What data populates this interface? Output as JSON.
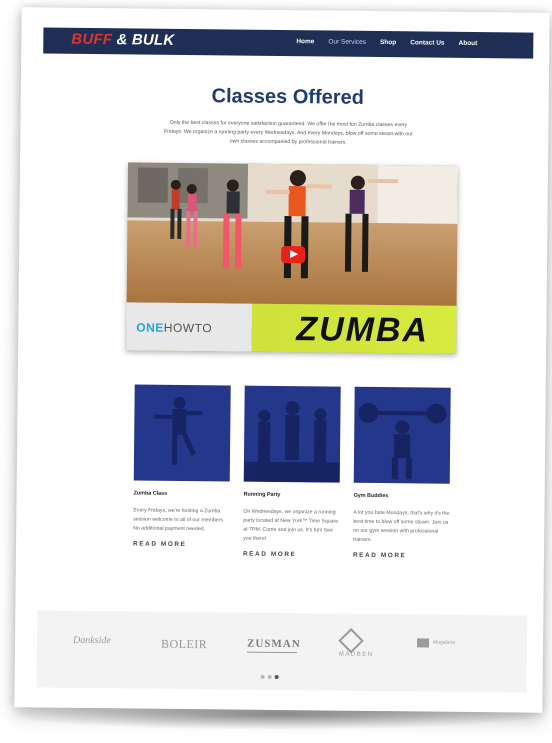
{
  "nav": {
    "logo_part1": "BUFF",
    "logo_part2": " & BULK",
    "links": [
      "Home",
      "Our Services",
      "Shop",
      "Contact Us",
      "About"
    ]
  },
  "main": {
    "title": "Classes Offered",
    "intro": "Only the best classes for everyone satisfaction guaranteed. We offer the most fun Zumba classes every Fridays. We organize a running party every Wednesdays. And every Mondays, blow off some steam with our own classes accompanied by professional trainers."
  },
  "video": {
    "brand_left_prefix": "ONE",
    "brand_left_suffix": "HOWTO",
    "brand_right": "ZUMBA"
  },
  "cards": [
    {
      "title": "Zumba Class",
      "text": "Every Fridays, we're hosting a Zumba session welcome to all of our members. No additional payment needed.",
      "more": "READ MORE"
    },
    {
      "title": "Running Party",
      "text": "On Wednesdays, we organize a running party located at New York™ Time Square at 7PM. Come and join us. It's fun! See you there!",
      "more": "READ MORE"
    },
    {
      "title": "Gym Buddies",
      "text": "A lot you hate Mondays, that's why it's the best time to blow off some steam. Join us on our gym session with professional trainers.",
      "more": "READ MORE"
    }
  ],
  "partners": [
    "Dankside",
    "BOLEIR",
    "ZUSMAN",
    "MADBEN",
    "Mugaluna"
  ],
  "carousel": {
    "active_index": 2,
    "count": 3
  },
  "colors": {
    "nav_bg": "#1f2e54",
    "title": "#1f3c73",
    "logo_accent": "#e0322b",
    "card_tint": "#24378a",
    "play": "#e62117"
  }
}
